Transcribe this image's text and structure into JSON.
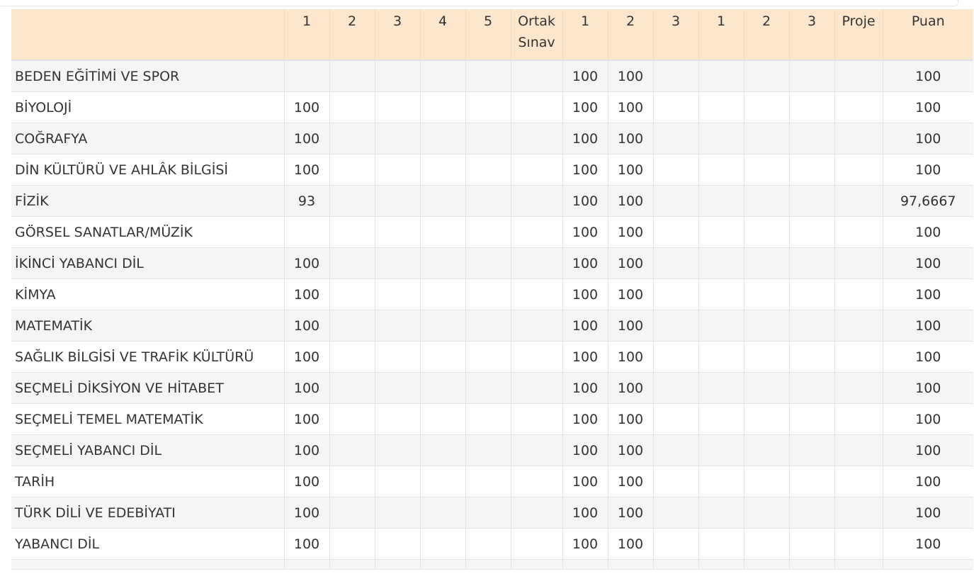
{
  "header": {
    "columns": [
      "",
      "1",
      "2",
      "3",
      "4",
      "5",
      "Ortak Sınav",
      "1",
      "2",
      "3",
      "1",
      "2",
      "3",
      "Proje",
      "Puan"
    ]
  },
  "rows": [
    {
      "ders": "BEDEN EĞİTİMİ VE SPOR",
      "cells": [
        "",
        "",
        "",
        "",
        "",
        "",
        "100",
        "100",
        "",
        "",
        "",
        "",
        "",
        "100"
      ]
    },
    {
      "ders": "BİYOLOJİ",
      "cells": [
        "100",
        "",
        "",
        "",
        "",
        "",
        "100",
        "100",
        "",
        "",
        "",
        "",
        "",
        "100"
      ]
    },
    {
      "ders": "COĞRAFYA",
      "cells": [
        "100",
        "",
        "",
        "",
        "",
        "",
        "100",
        "100",
        "",
        "",
        "",
        "",
        "",
        "100"
      ]
    },
    {
      "ders": "DİN KÜLTÜRÜ VE AHLÂK BİLGİSİ",
      "cells": [
        "100",
        "",
        "",
        "",
        "",
        "",
        "100",
        "100",
        "",
        "",
        "",
        "",
        "",
        "100"
      ]
    },
    {
      "ders": "FİZİK",
      "cells": [
        "93",
        "",
        "",
        "",
        "",
        "",
        "100",
        "100",
        "",
        "",
        "",
        "",
        "",
        "97,6667"
      ]
    },
    {
      "ders": "GÖRSEL SANATLAR/MÜZİK",
      "cells": [
        "",
        "",
        "",
        "",
        "",
        "",
        "100",
        "100",
        "",
        "",
        "",
        "",
        "",
        "100"
      ]
    },
    {
      "ders": "İKİNCİ YABANCI DİL",
      "cells": [
        "100",
        "",
        "",
        "",
        "",
        "",
        "100",
        "100",
        "",
        "",
        "",
        "",
        "",
        "100"
      ]
    },
    {
      "ders": "KİMYA",
      "cells": [
        "100",
        "",
        "",
        "",
        "",
        "",
        "100",
        "100",
        "",
        "",
        "",
        "",
        "",
        "100"
      ]
    },
    {
      "ders": "MATEMATİK",
      "cells": [
        "100",
        "",
        "",
        "",
        "",
        "",
        "100",
        "100",
        "",
        "",
        "",
        "",
        "",
        "100"
      ]
    },
    {
      "ders": "SAĞLIK BİLGİSİ VE TRAFİK KÜLTÜRÜ",
      "cells": [
        "100",
        "",
        "",
        "",
        "",
        "",
        "100",
        "100",
        "",
        "",
        "",
        "",
        "",
        "100"
      ]
    },
    {
      "ders": "SEÇMELİ DİKSİYON VE HİTABET",
      "cells": [
        "100",
        "",
        "",
        "",
        "",
        "",
        "100",
        "100",
        "",
        "",
        "",
        "",
        "",
        "100"
      ]
    },
    {
      "ders": "SEÇMELİ TEMEL MATEMATİK",
      "cells": [
        "100",
        "",
        "",
        "",
        "",
        "",
        "100",
        "100",
        "",
        "",
        "",
        "",
        "",
        "100"
      ]
    },
    {
      "ders": "SEÇMELİ YABANCI DİL",
      "cells": [
        "100",
        "",
        "",
        "",
        "",
        "",
        "100",
        "100",
        "",
        "",
        "",
        "",
        "",
        "100"
      ]
    },
    {
      "ders": "TARİH",
      "cells": [
        "100",
        "",
        "",
        "",
        "",
        "",
        "100",
        "100",
        "",
        "",
        "",
        "",
        "",
        "100"
      ]
    },
    {
      "ders": "TÜRK DİLİ VE EDEBİYATI",
      "cells": [
        "100",
        "",
        "",
        "",
        "",
        "",
        "100",
        "100",
        "",
        "",
        "",
        "",
        "",
        "100"
      ]
    },
    {
      "ders": "YABANCI DİL",
      "cells": [
        "100",
        "",
        "",
        "",
        "",
        "",
        "100",
        "100",
        "",
        "",
        "",
        "",
        "",
        "100"
      ]
    }
  ],
  "colors": {
    "header_bg": "#fde7cc",
    "row_odd_bg": "#f5f5f5",
    "row_even_bg": "#ffffff",
    "text": "#333333",
    "border": "#e4e4e4"
  }
}
